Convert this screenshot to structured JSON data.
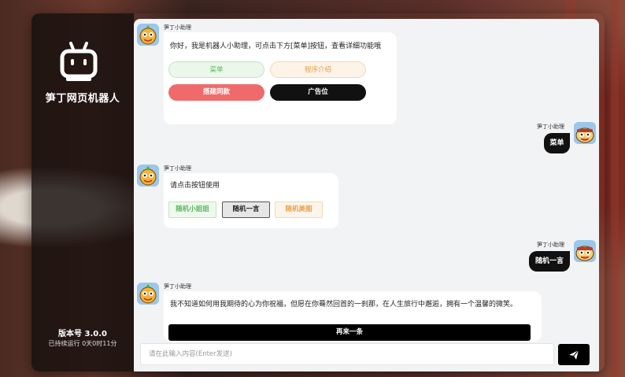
{
  "sidebar": {
    "app_name": "笋丁网页机器人",
    "version": "版本号 3.0.0",
    "uptime": "已持续运行 0天0时11分"
  },
  "messages": [
    {
      "sender": "笋丁小助理",
      "text": "你好，我是机器人小助理，可点击下方[菜单]按钮，查看详细功能哦",
      "buttons": [
        "菜单",
        "程序介绍",
        "搭建同款",
        "广告位"
      ]
    },
    {
      "sender": "笋丁小助理",
      "text": "菜单"
    },
    {
      "sender": "笋丁小助理",
      "text": "请点击按钮使用",
      "buttons": [
        "随机小姐姐",
        "随机一言",
        "随机美图"
      ]
    },
    {
      "sender": "笋丁小助理",
      "text": "随机一言"
    },
    {
      "sender": "笋丁小助理",
      "text": "我不知道如何用我期待的心为你祝福，但愿在你蓦然回首的一刹那，在人生旅行中邂逅，拥有一个温馨的微笑。",
      "buttons": [
        "再来一条"
      ]
    }
  ],
  "input": {
    "placeholder": "请在此输入内容(Enter发送)"
  },
  "icons": {
    "logo": "robot-icon",
    "avatar": "cartoon-mascot-avatar",
    "send": "paper-plane-icon"
  },
  "colors": {
    "accent": "#000000",
    "menu_green": "#5cb85c",
    "intro_orange": "#e0a050",
    "build_red": "#ef6b6b"
  }
}
